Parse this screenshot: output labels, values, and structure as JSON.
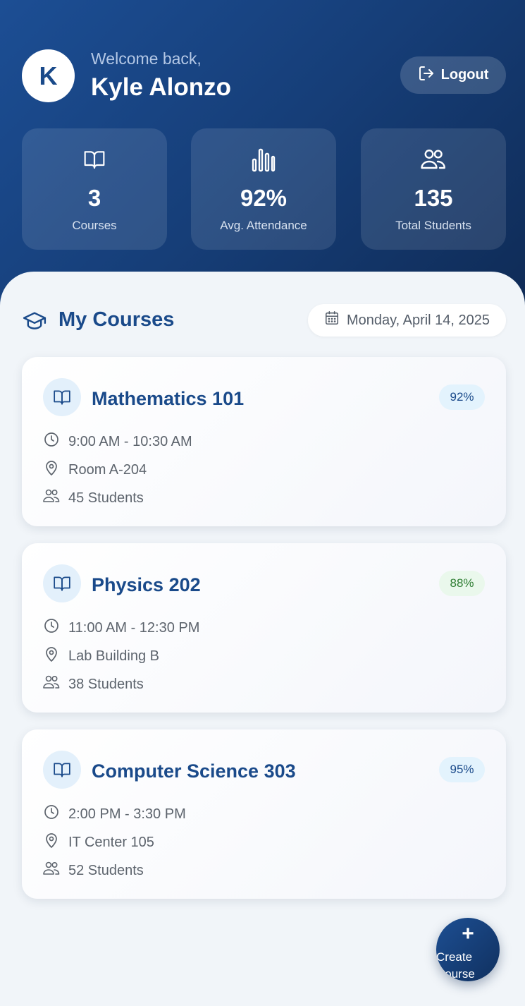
{
  "header": {
    "avatar_initial": "K",
    "welcome": "Welcome back,",
    "user_name": "Kyle Alonzo",
    "logout_label": "Logout"
  },
  "stats": [
    {
      "icon": "book-icon",
      "value": "3",
      "label": "Courses"
    },
    {
      "icon": "bar-chart-icon",
      "value": "92%",
      "label": "Avg. Attendance"
    },
    {
      "icon": "users-icon",
      "value": "135",
      "label": "Total Students"
    }
  ],
  "section": {
    "title": "My Courses",
    "icon": "graduation-cap-icon",
    "date": "Monday, April 14, 2025"
  },
  "courses": [
    {
      "title": "Mathematics 101",
      "attendance": "92%",
      "time": "9:00 AM - 10:30 AM",
      "location": "Room A-204",
      "students": "45 Students",
      "badge_bg": "#e3f3fd",
      "badge_color": "#1a4a8a"
    },
    {
      "title": "Physics 202",
      "attendance": "88%",
      "time": "11:00 AM - 12:30 PM",
      "location": "Lab Building B",
      "students": "38 Students",
      "badge_bg": "#eaf8ec",
      "badge_color": "#2e7d32"
    },
    {
      "title": "Computer Science 303",
      "attendance": "95%",
      "time": "2:00 PM - 3:30 PM",
      "location": "IT Center 105",
      "students": "52 Students",
      "badge_bg": "#e3f3fd",
      "badge_color": "#1a4a8a"
    }
  ],
  "fab": {
    "plus": "+",
    "label": "Create Course"
  },
  "colors": {
    "primary": "#1a4a8a",
    "header_dark": "#0f2b56",
    "background": "#f1f5f9"
  }
}
